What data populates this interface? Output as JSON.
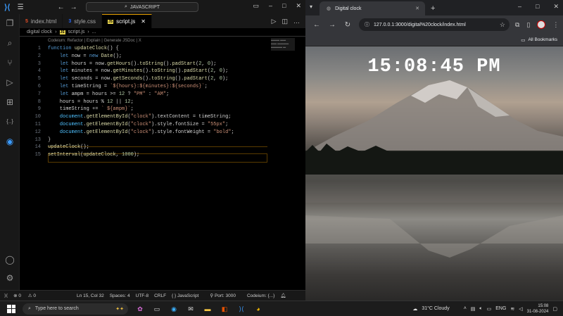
{
  "vscode": {
    "search_text": "JAVASCRIPT",
    "tabs": [
      {
        "label": "index.html"
      },
      {
        "label": "style.css"
      },
      {
        "label": "script.js"
      }
    ],
    "breadcrumb": {
      "folder": "digital clock",
      "file": "script.js",
      "more": "..."
    },
    "codelens": "Codeium: Refactor | Explain | Generate JSDoc | X",
    "line_numbers": [
      "1",
      "2",
      "3",
      "4",
      "5",
      "6",
      "7",
      "8",
      "9",
      "10",
      "11",
      "12",
      "13",
      "14",
      "15"
    ],
    "code_lines": [
      "function updateClock() {",
      "    let now = new Date();",
      "    let hours = now.getHours().toString().padStart(2, 0);",
      "    let minutes = now.getMinutes().toString().padStart(2, 0);",
      "    let seconds = now.getSeconds().toString().padStart(2, 0);",
      "    let timeString = `${hours}:${minutes}:${seconds}`;",
      "    let ampm = hours >= 12 ? \"PM\" : \"AM\";",
      "    hours = hours % 12 || 12;",
      "    timeString += ` ${ampm}`;",
      "    document.getElementById(\"clock\").textContent = timeString;",
      "    document.getElementById(\"clock\").style.fontSize = \"55px\";",
      "    document.getElementById(\"clock\").style.fontWeight = \"bold\";",
      "}",
      "updateClock();",
      "setInterval(updateClock, 1000);"
    ],
    "status": {
      "errors": "0",
      "warnings": "0",
      "position": "Ln 15, Col 32",
      "spaces": "Spaces: 4",
      "encoding": "UTF-8",
      "eol": "CRLF",
      "language": "JavaScript",
      "port": "Port: 3000",
      "codeium": "Codeium: {...}"
    }
  },
  "browser": {
    "tab_title": "Digital clock",
    "url": "127.0.0.1:3000/digital%20clock/index.html",
    "bookmarks": "All Bookmarks",
    "clock_text": "15:08:45 PM"
  },
  "taskbar": {
    "search_placeholder": "Type here to search",
    "weather": "31°C  Cloudy",
    "lang": "ENG",
    "time": "15:08",
    "date": "31-08-2024"
  }
}
